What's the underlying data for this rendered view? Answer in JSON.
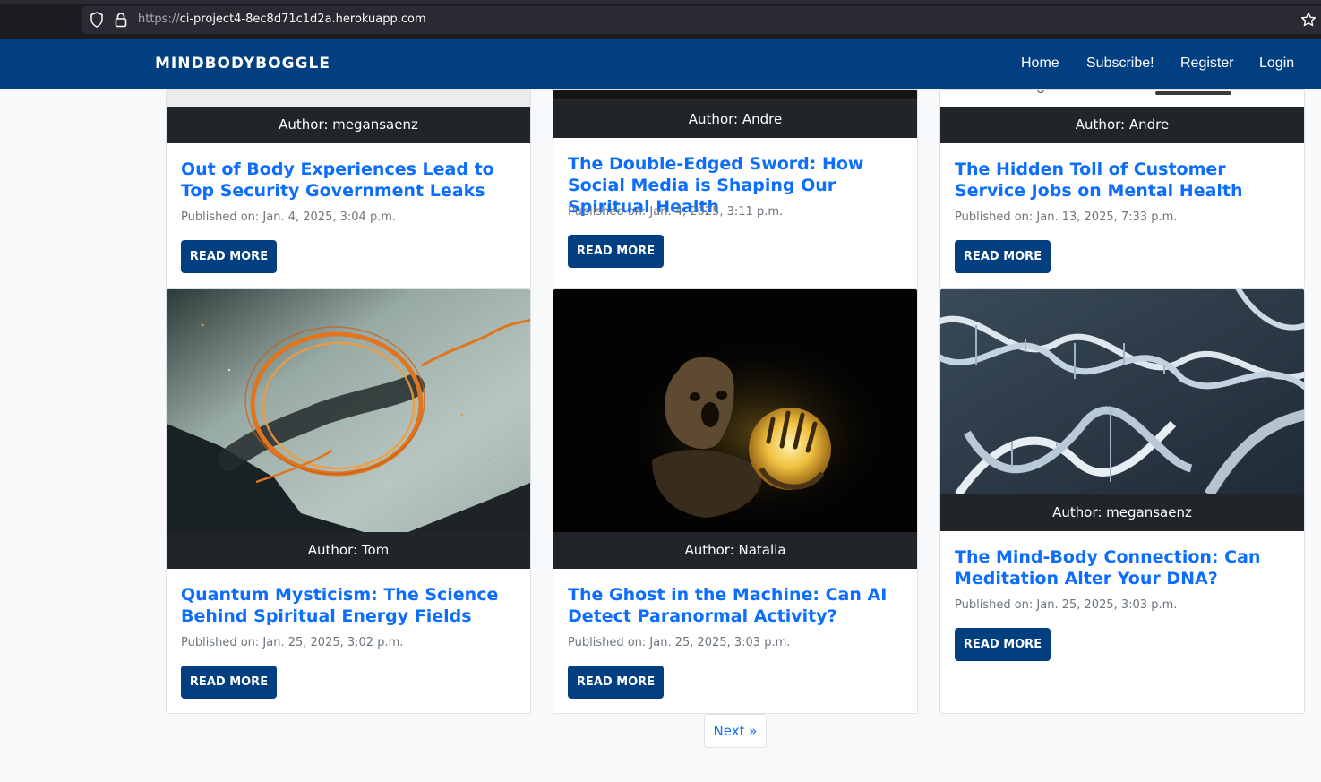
{
  "browser": {
    "url_scheme": "https://",
    "url_host": "ci-project4-8ec8d71c1d2a.herokuapp.com"
  },
  "navbar": {
    "brand": "MINDBODYBOGGLE",
    "links": [
      "Home",
      "Subscribe!",
      "Register",
      "Login"
    ]
  },
  "posts": [
    {
      "author": "Author: megansaenz",
      "title": "Out of Body Experiences Lead to Top Security Government Leaks",
      "published": "Published on: Jan. 4, 2025, 3:04 p.m.",
      "button": "READ MORE"
    },
    {
      "author": "Author: Andre",
      "title": "The Double-Edged Sword: How Social Media is Shaping Our Spiritual Health",
      "published": "Published on: Jan. 4, 2025, 3:11 p.m.",
      "button": "READ MORE"
    },
    {
      "author": "Author: Andre",
      "title": "The Hidden Toll of Customer Service Jobs on Mental Health",
      "published": "Published on: Jan. 13, 2025, 7:33 p.m.",
      "button": "READ MORE"
    },
    {
      "author": "Author: Tom",
      "title": "Quantum Mysticism: The Science Behind Spiritual Energy Fields",
      "published": "Published on: Jan. 25, 2025, 3:02 p.m.",
      "button": "READ MORE"
    },
    {
      "author": "Author: Natalia",
      "title": "The Ghost in the Machine: Can AI Detect Paranormal Activity?",
      "published": "Published on: Jan. 25, 2025, 3:03 p.m.",
      "button": "READ MORE"
    },
    {
      "author": "Author: megansaenz",
      "title": "The Mind-Body Connection: Can Meditation Alter Your DNA?",
      "published": "Published on: Jan. 25, 2025, 3:03 p.m.",
      "button": "READ MORE"
    }
  ],
  "pagination": {
    "next_label": "Next »"
  },
  "colors": {
    "navbar": "#013f80",
    "link": "#0d6efd",
    "author_bar": "#212529",
    "background": "#f8f9fa"
  }
}
